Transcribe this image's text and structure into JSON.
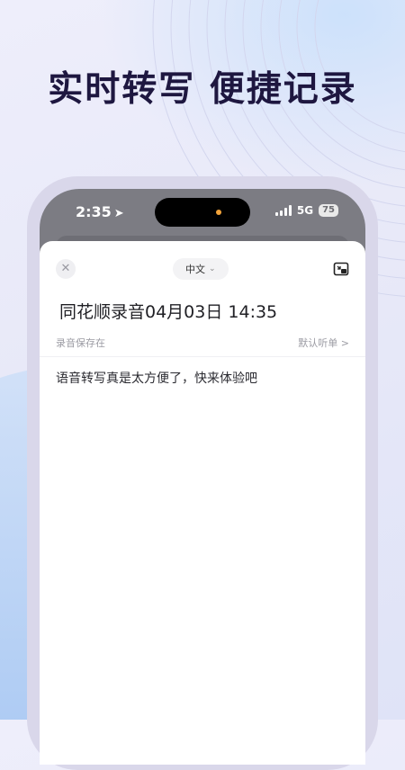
{
  "headline": "实时转写 便捷记录",
  "status_bar": {
    "time": "2:35",
    "network": "5G",
    "battery": "75",
    "icons": [
      "location-arrow-icon",
      "signal-bars-icon",
      "battery-icon"
    ]
  },
  "toolbar": {
    "language": "中文",
    "icons": [
      "close-icon",
      "chevron-down-icon",
      "picture-in-picture-icon"
    ]
  },
  "note": {
    "title": "同花顺录音04月03日 14:35",
    "save_status": "录音保存在",
    "playlist_link": "默认听单 >",
    "transcript": "语音转写真是太方便了，快来体验吧"
  },
  "colors": {
    "headline": "#1e1740",
    "phone_frame": "#d9d7ea",
    "screen_dim": "#7c7c83",
    "island_dot": "#f2a33a"
  }
}
